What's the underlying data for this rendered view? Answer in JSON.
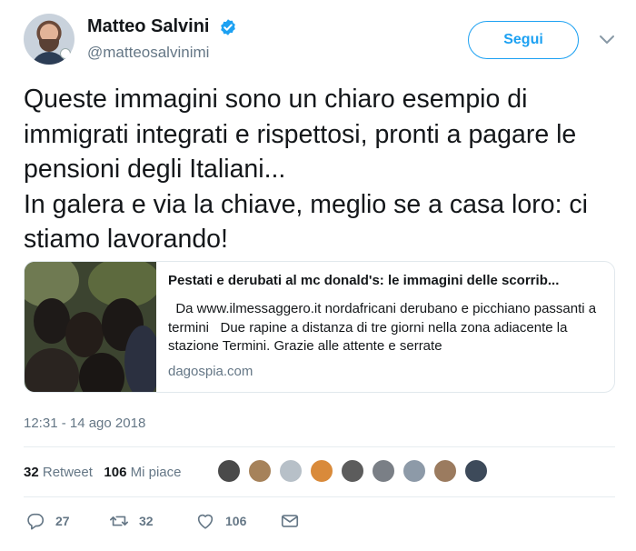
{
  "author": {
    "display_name": "Matteo Salvini",
    "handle": "@matteosalvinimi",
    "verified": true
  },
  "header": {
    "follow_label": "Segui"
  },
  "tweet": {
    "text": "Queste immagini sono un chiaro esempio di immigrati integrati e rispettosi, pronti a pagare le pensioni degli Italiani...\nIn galera e via la chiave, meglio se a casa loro: ci stiamo lavorando!",
    "timestamp": "12:31 - 14 ago 2018"
  },
  "card": {
    "title": "Pestati e derubati al mc donald's: le immagini delle scorrib...",
    "description": "  Da www.ilmessaggero.it nordafricani derubano e picchiano passanti a termini   Due rapine a distanza di tre giorni nella zona adiacente la stazione Termini. Grazie alle attente e serrate",
    "domain": "dagospia.com"
  },
  "stats": {
    "retweets_count": "32",
    "retweets_label": "Retweet",
    "likes_count": "106",
    "likes_label": "Mi piace"
  },
  "actions": {
    "reply_count": "27",
    "retweet_count": "32",
    "like_count": "106"
  },
  "colors": {
    "accent": "#1da1f2",
    "muted": "#657786",
    "text": "#14171a",
    "border": "#e1e8ed"
  },
  "icons": [
    "verified-badge-icon",
    "chevron-down-icon",
    "reply-icon",
    "retweet-icon",
    "heart-icon",
    "message-icon"
  ],
  "likers": [
    {
      "color": "#4a4a4a"
    },
    {
      "color": "#a6825a"
    },
    {
      "color": "#b7c0c8"
    },
    {
      "color": "#d98a3a"
    },
    {
      "color": "#5c5c5c"
    },
    {
      "color": "#7a7f86"
    },
    {
      "color": "#8d9aa8"
    },
    {
      "color": "#9b7b5f"
    },
    {
      "color": "#3d4a5a"
    }
  ]
}
